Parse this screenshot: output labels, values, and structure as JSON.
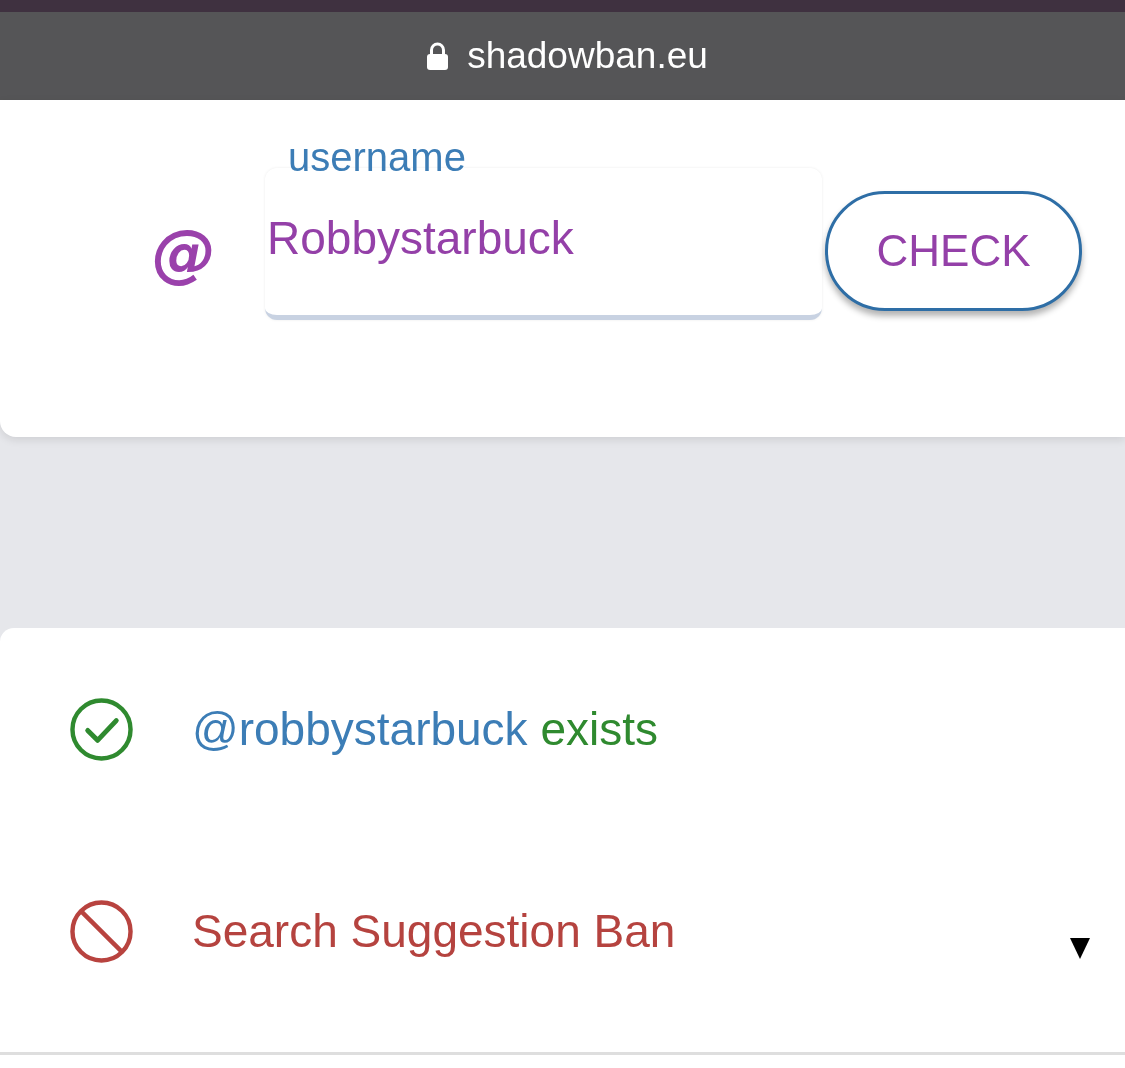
{
  "browser": {
    "secure": true,
    "address": "shadowban.eu"
  },
  "form": {
    "prefix": "@",
    "field": {
      "label": "username",
      "value": "Robbystarbuck"
    },
    "button": "CHECK"
  },
  "results": [
    {
      "kind": "user",
      "passed": true,
      "handle": "@robbystarbuck",
      "verdict": "exists"
    },
    {
      "kind": "test",
      "passed": false,
      "title": "Search Suggestion Ban",
      "expanded": false
    }
  ]
}
